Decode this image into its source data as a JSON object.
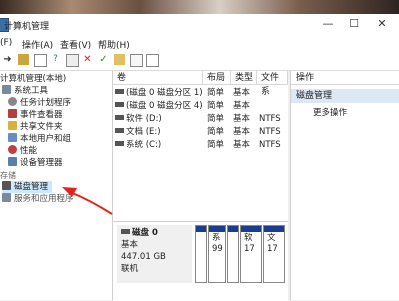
{
  "window": {
    "title": "计算机管理"
  },
  "menu": [
    {
      "label": "(F)"
    },
    {
      "label": "操作(A)"
    },
    {
      "label": "查看(V)"
    },
    {
      "label": "帮助(H)"
    }
  ],
  "tree": {
    "root": "计算机管理(本地)",
    "system_tools": "系统工具",
    "task_scheduler": "任务计划程序",
    "event_viewer": "事件查看器",
    "shared_folders": "共享文件夹",
    "local_users": "本地用户和组",
    "performance": "性能",
    "device_manager": "设备管理器",
    "storage": "存储",
    "disk_management": "磁盘管理",
    "services": "服务和应用程序"
  },
  "columns": [
    "卷",
    "布局",
    "类型",
    "文件系"
  ],
  "volumes": [
    {
      "name": "(磁盘 0 磁盘分区 1)",
      "layout": "简单",
      "type": "基本",
      "fs": ""
    },
    {
      "name": "(磁盘 0 磁盘分区 4)",
      "layout": "简单",
      "type": "基本",
      "fs": ""
    },
    {
      "name": "软件 (D:)",
      "layout": "简单",
      "type": "基本",
      "fs": "NTFS"
    },
    {
      "name": "文档 (E:)",
      "layout": "简单",
      "type": "基本",
      "fs": "NTFS"
    },
    {
      "name": "系统 (C:)",
      "layout": "简单",
      "type": "基本",
      "fs": "NTFS"
    }
  ],
  "actions": {
    "header": "操作",
    "section": "磁盘管理",
    "more": "更多操作"
  },
  "disk": {
    "name": "磁盘 0",
    "type": "基本",
    "size": "447.01 GB",
    "status": "联机",
    "partitions": [
      {
        "line1": "",
        "line2": ""
      },
      {
        "line1": "系",
        "line2": "99"
      },
      {
        "line1": "",
        "line2": ""
      },
      {
        "line1": "软",
        "line2": "17"
      },
      {
        "line1": "文",
        "line2": "17"
      }
    ]
  },
  "colors": {
    "partition_bar": "#1c3d8f",
    "selection": "#cce8ff",
    "annotation_arrow": "#e2231a"
  }
}
